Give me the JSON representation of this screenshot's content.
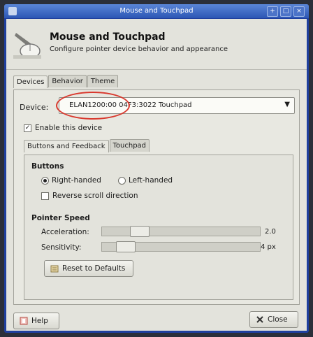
{
  "window": {
    "title": "Mouse and Touchpad",
    "controls": [
      "+",
      "□",
      "×"
    ]
  },
  "header": {
    "title": "Mouse and Touchpad",
    "subtitle": "Configure pointer device behavior and appearance",
    "icon": "mouse-settings-icon"
  },
  "tabs": [
    "Devices",
    "Behavior",
    "Theme"
  ],
  "device": {
    "label": "Device:",
    "selected": "ELAN1200:00 04F3:3022 Touchpad",
    "highlight_color": "#d9392e"
  },
  "enable_device": {
    "label": "Enable this device",
    "checked": true
  },
  "subtabs": [
    "Buttons and Feedback",
    "Touchpad"
  ],
  "buttons_section": {
    "title": "Buttons",
    "right_handed": "Right-handed",
    "left_handed": "Left-handed",
    "selected": "Right-handed",
    "reverse_scroll": "Reverse scroll direction",
    "reverse_scroll_checked": false
  },
  "pointer_speed": {
    "title": "Pointer Speed",
    "acceleration": {
      "label": "Acceleration:",
      "value": "2.0",
      "fraction": 0.2
    },
    "sensitivity": {
      "label": "Sensitivity:",
      "value": "4 px",
      "fraction": 0.1
    }
  },
  "reset_button": "Reset to Defaults",
  "help_button": "Help",
  "close_button": "Close"
}
